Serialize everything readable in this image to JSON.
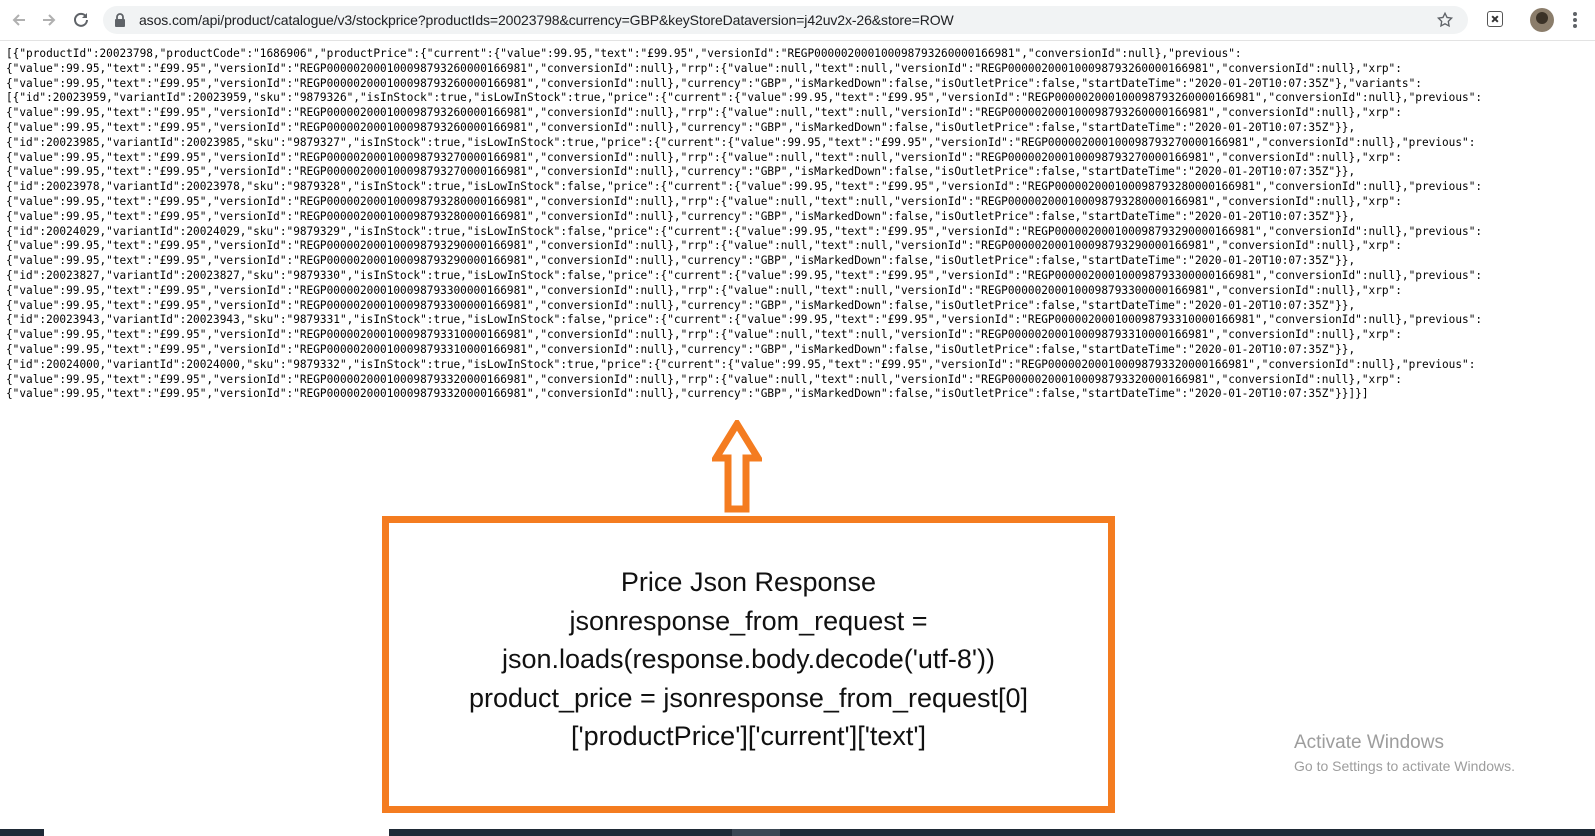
{
  "browser": {
    "url": "asos.com/api/product/catalogue/v3/stockprice?productIds=20023798&currency=GBP&keyStoreDataversion=j42uv2x-26&store=ROW"
  },
  "json_lines": [
    "[{\"productId\":20023798,\"productCode\":\"1686906\",\"productPrice\":{\"current\":{\"value\":99.95,\"text\":\"£99.95\",\"versionId\":\"REGP000002000100098793260000166981\",\"conversionId\":null},\"previous\":",
    "{\"value\":99.95,\"text\":\"£99.95\",\"versionId\":\"REGP000002000100098793260000166981\",\"conversionId\":null},\"rrp\":{\"value\":null,\"text\":null,\"versionId\":\"REGP000002000100098793260000166981\",\"conversionId\":null},\"xrp\":",
    "{\"value\":99.95,\"text\":\"£99.95\",\"versionId\":\"REGP000002000100098793260000166981\",\"conversionId\":null},\"currency\":\"GBP\",\"isMarkedDown\":false,\"isOutletPrice\":false,\"startDateTime\":\"2020-01-20T10:07:35Z\"},\"variants\":",
    "[{\"id\":20023959,\"variantId\":20023959,\"sku\":\"9879326\",\"isInStock\":true,\"isLowInStock\":true,\"price\":{\"current\":{\"value\":99.95,\"text\":\"£99.95\",\"versionId\":\"REGP000002000100098793260000166981\",\"conversionId\":null},\"previous\":",
    "{\"value\":99.95,\"text\":\"£99.95\",\"versionId\":\"REGP000002000100098793260000166981\",\"conversionId\":null},\"rrp\":{\"value\":null,\"text\":null,\"versionId\":\"REGP000002000100098793260000166981\",\"conversionId\":null},\"xrp\":",
    "{\"value\":99.95,\"text\":\"£99.95\",\"versionId\":\"REGP000002000100098793260000166981\",\"conversionId\":null},\"currency\":\"GBP\",\"isMarkedDown\":false,\"isOutletPrice\":false,\"startDateTime\":\"2020-01-20T10:07:35Z\"}},",
    "{\"id\":20023985,\"variantId\":20023985,\"sku\":\"9879327\",\"isInStock\":true,\"isLowInStock\":true,\"price\":{\"current\":{\"value\":99.95,\"text\":\"£99.95\",\"versionId\":\"REGP000002000100098793270000166981\",\"conversionId\":null},\"previous\":",
    "{\"value\":99.95,\"text\":\"£99.95\",\"versionId\":\"REGP000002000100098793270000166981\",\"conversionId\":null},\"rrp\":{\"value\":null,\"text\":null,\"versionId\":\"REGP000002000100098793270000166981\",\"conversionId\":null},\"xrp\":",
    "{\"value\":99.95,\"text\":\"£99.95\",\"versionId\":\"REGP000002000100098793270000166981\",\"conversionId\":null},\"currency\":\"GBP\",\"isMarkedDown\":false,\"isOutletPrice\":false,\"startDateTime\":\"2020-01-20T10:07:35Z\"}},",
    "{\"id\":20023978,\"variantId\":20023978,\"sku\":\"9879328\",\"isInStock\":true,\"isLowInStock\":false,\"price\":{\"current\":{\"value\":99.95,\"text\":\"£99.95\",\"versionId\":\"REGP000002000100098793280000166981\",\"conversionId\":null},\"previous\":",
    "{\"value\":99.95,\"text\":\"£99.95\",\"versionId\":\"REGP000002000100098793280000166981\",\"conversionId\":null},\"rrp\":{\"value\":null,\"text\":null,\"versionId\":\"REGP000002000100098793280000166981\",\"conversionId\":null},\"xrp\":",
    "{\"value\":99.95,\"text\":\"£99.95\",\"versionId\":\"REGP000002000100098793280000166981\",\"conversionId\":null},\"currency\":\"GBP\",\"isMarkedDown\":false,\"isOutletPrice\":false,\"startDateTime\":\"2020-01-20T10:07:35Z\"}},",
    "{\"id\":20024029,\"variantId\":20024029,\"sku\":\"9879329\",\"isInStock\":true,\"isLowInStock\":false,\"price\":{\"current\":{\"value\":99.95,\"text\":\"£99.95\",\"versionId\":\"REGP000002000100098793290000166981\",\"conversionId\":null},\"previous\":",
    "{\"value\":99.95,\"text\":\"£99.95\",\"versionId\":\"REGP000002000100098793290000166981\",\"conversionId\":null},\"rrp\":{\"value\":null,\"text\":null,\"versionId\":\"REGP000002000100098793290000166981\",\"conversionId\":null},\"xrp\":",
    "{\"value\":99.95,\"text\":\"£99.95\",\"versionId\":\"REGP000002000100098793290000166981\",\"conversionId\":null},\"currency\":\"GBP\",\"isMarkedDown\":false,\"isOutletPrice\":false,\"startDateTime\":\"2020-01-20T10:07:35Z\"}},",
    "{\"id\":20023827,\"variantId\":20023827,\"sku\":\"9879330\",\"isInStock\":true,\"isLowInStock\":false,\"price\":{\"current\":{\"value\":99.95,\"text\":\"£99.95\",\"versionId\":\"REGP000002000100098793300000166981\",\"conversionId\":null},\"previous\":",
    "{\"value\":99.95,\"text\":\"£99.95\",\"versionId\":\"REGP000002000100098793300000166981\",\"conversionId\":null},\"rrp\":{\"value\":null,\"text\":null,\"versionId\":\"REGP000002000100098793300000166981\",\"conversionId\":null},\"xrp\":",
    "{\"value\":99.95,\"text\":\"£99.95\",\"versionId\":\"REGP000002000100098793300000166981\",\"conversionId\":null},\"currency\":\"GBP\",\"isMarkedDown\":false,\"isOutletPrice\":false,\"startDateTime\":\"2020-01-20T10:07:35Z\"}},",
    "{\"id\":20023943,\"variantId\":20023943,\"sku\":\"9879331\",\"isInStock\":true,\"isLowInStock\":false,\"price\":{\"current\":{\"value\":99.95,\"text\":\"£99.95\",\"versionId\":\"REGP000002000100098793310000166981\",\"conversionId\":null},\"previous\":",
    "{\"value\":99.95,\"text\":\"£99.95\",\"versionId\":\"REGP000002000100098793310000166981\",\"conversionId\":null},\"rrp\":{\"value\":null,\"text\":null,\"versionId\":\"REGP000002000100098793310000166981\",\"conversionId\":null},\"xrp\":",
    "{\"value\":99.95,\"text\":\"£99.95\",\"versionId\":\"REGP000002000100098793310000166981\",\"conversionId\":null},\"currency\":\"GBP\",\"isMarkedDown\":false,\"isOutletPrice\":false,\"startDateTime\":\"2020-01-20T10:07:35Z\"}},",
    "{\"id\":20024000,\"variantId\":20024000,\"sku\":\"9879332\",\"isInStock\":true,\"isLowInStock\":true,\"price\":{\"current\":{\"value\":99.95,\"text\":\"£99.95\",\"versionId\":\"REGP000002000100098793320000166981\",\"conversionId\":null},\"previous\":",
    "{\"value\":99.95,\"text\":\"£99.95\",\"versionId\":\"REGP000002000100098793320000166981\",\"conversionId\":null},\"rrp\":{\"value\":null,\"text\":null,\"versionId\":\"REGP000002000100098793320000166981\",\"conversionId\":null},\"xrp\":",
    "{\"value\":99.95,\"text\":\"£99.95\",\"versionId\":\"REGP000002000100098793320000166981\",\"conversionId\":null},\"currency\":\"GBP\",\"isMarkedDown\":false,\"isOutletPrice\":false,\"startDateTime\":\"2020-01-20T10:07:35Z\"}}]}]"
  ],
  "callout": {
    "lines": [
      "Price Json Response",
      "jsonresponse_from_request =",
      "json.loads(response.body.decode('utf-8'))",
      "product_price = jsonresponse_from_request[0]",
      "['productPrice']['current']['text']"
    ],
    "border_color": "#f47c20"
  },
  "watermark": {
    "line1": "Activate Windows",
    "line2": "Go to Settings to activate Windows."
  },
  "icons": {
    "back": "arrow-left-icon",
    "forward": "arrow-right-icon",
    "reload": "reload-icon",
    "lock": "lock-icon",
    "star": "star-icon",
    "extension": "extension-icon",
    "menu": "more-vert-icon"
  }
}
